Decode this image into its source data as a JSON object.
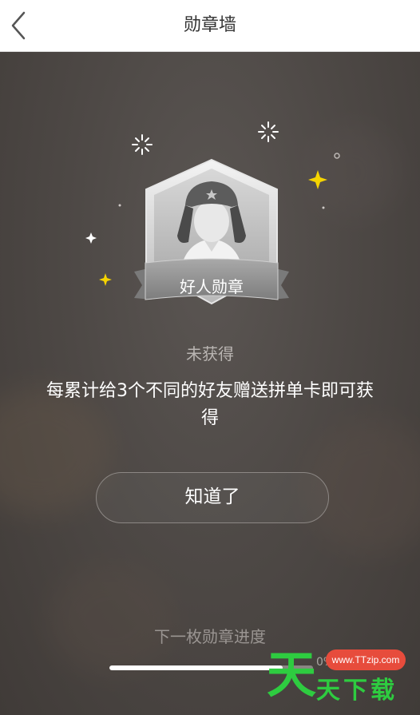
{
  "header": {
    "title": "勋章墙",
    "back_icon": "chevron-left-icon"
  },
  "badge": {
    "name": "好人勋章",
    "status": "未获得",
    "description": "每累计给3个不同的好友赠送拼单卡即可获得"
  },
  "actions": {
    "confirm_label": "知道了"
  },
  "progress": {
    "label": "下一枚勋章进度",
    "value_text": "0%",
    "fraction": 0.85
  },
  "watermark": {
    "site": "www.TTzip.com",
    "big_char": "天",
    "small_chars": "天下载"
  },
  "colors": {
    "background": "#4a4542",
    "accent_star": "#f5d400",
    "watermark_green": "#2ecc40",
    "watermark_red": "#e74c3c"
  }
}
